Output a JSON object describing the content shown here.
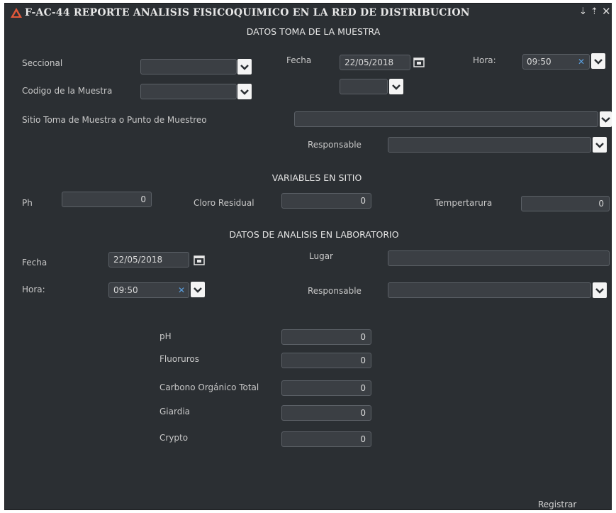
{
  "window": {
    "title": "F-AC-44 REPORTE ANALISIS FISICOQUIMICO EN LA RED DE DISTRIBUCION",
    "pin_icon": "pin-icon",
    "close_icon": "close-icon",
    "minimize_icon": "dock-icon"
  },
  "colors": {
    "background": "#2b2f33",
    "field": "#3b3f44",
    "field_border": "#5b6066",
    "text": "#d9d9d9",
    "accent_clear": "#5aa0e0"
  },
  "sections": {
    "toma": "DATOS TOMA DE LA MUESTRA",
    "variables": "VARIABLES EN SITIO",
    "laboratorio": "DATOS DE ANALISIS EN LABORATORIO"
  },
  "toma": {
    "seccional_label": "Seccional",
    "codigo_label": "Codigo de la Muestra",
    "sitio_label": "Sitio Toma de Muestra o Punto de Muestreo",
    "responsable_label": "Responsable",
    "fecha_label": "Fecha",
    "fecha_value": "22/05/2018",
    "hora_label": "Hora:",
    "hora_value": "09:50"
  },
  "variables": {
    "ph_label": "Ph",
    "ph_value": "0",
    "cloro_label": "Cloro Residual",
    "cloro_value": "0",
    "temp_label": "Tempertarura",
    "temp_value": "0"
  },
  "laboratorio": {
    "fecha_label": "Fecha",
    "fecha_value": "22/05/2018",
    "hora_label": "Hora:",
    "hora_value": "09:50",
    "lugar_label": "Lugar",
    "responsable_label": "Responsable",
    "ph_label": "pH",
    "ph_value": "0",
    "fluoruros_label": "Fluoruros",
    "fluoruros_value": "0",
    "carbono_label": "Carbono Orgánico Total",
    "carbono_value": "0",
    "giardia_label": "Giardia",
    "giardia_value": "0",
    "crypto_label": "Crypto",
    "crypto_value": "0"
  },
  "actions": {
    "registrar": "Registrar"
  }
}
